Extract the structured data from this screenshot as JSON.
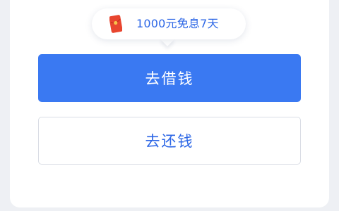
{
  "promo": {
    "icon": "red-packet-icon",
    "text": "1000元免息7天"
  },
  "actions": {
    "borrow_label": "去借钱",
    "repay_label": "去还钱"
  },
  "colors": {
    "primary": "#3a79f2",
    "primary_text": "#2d67e6",
    "red_packet": "#e8452f",
    "page_bg": "#eef0f4"
  }
}
